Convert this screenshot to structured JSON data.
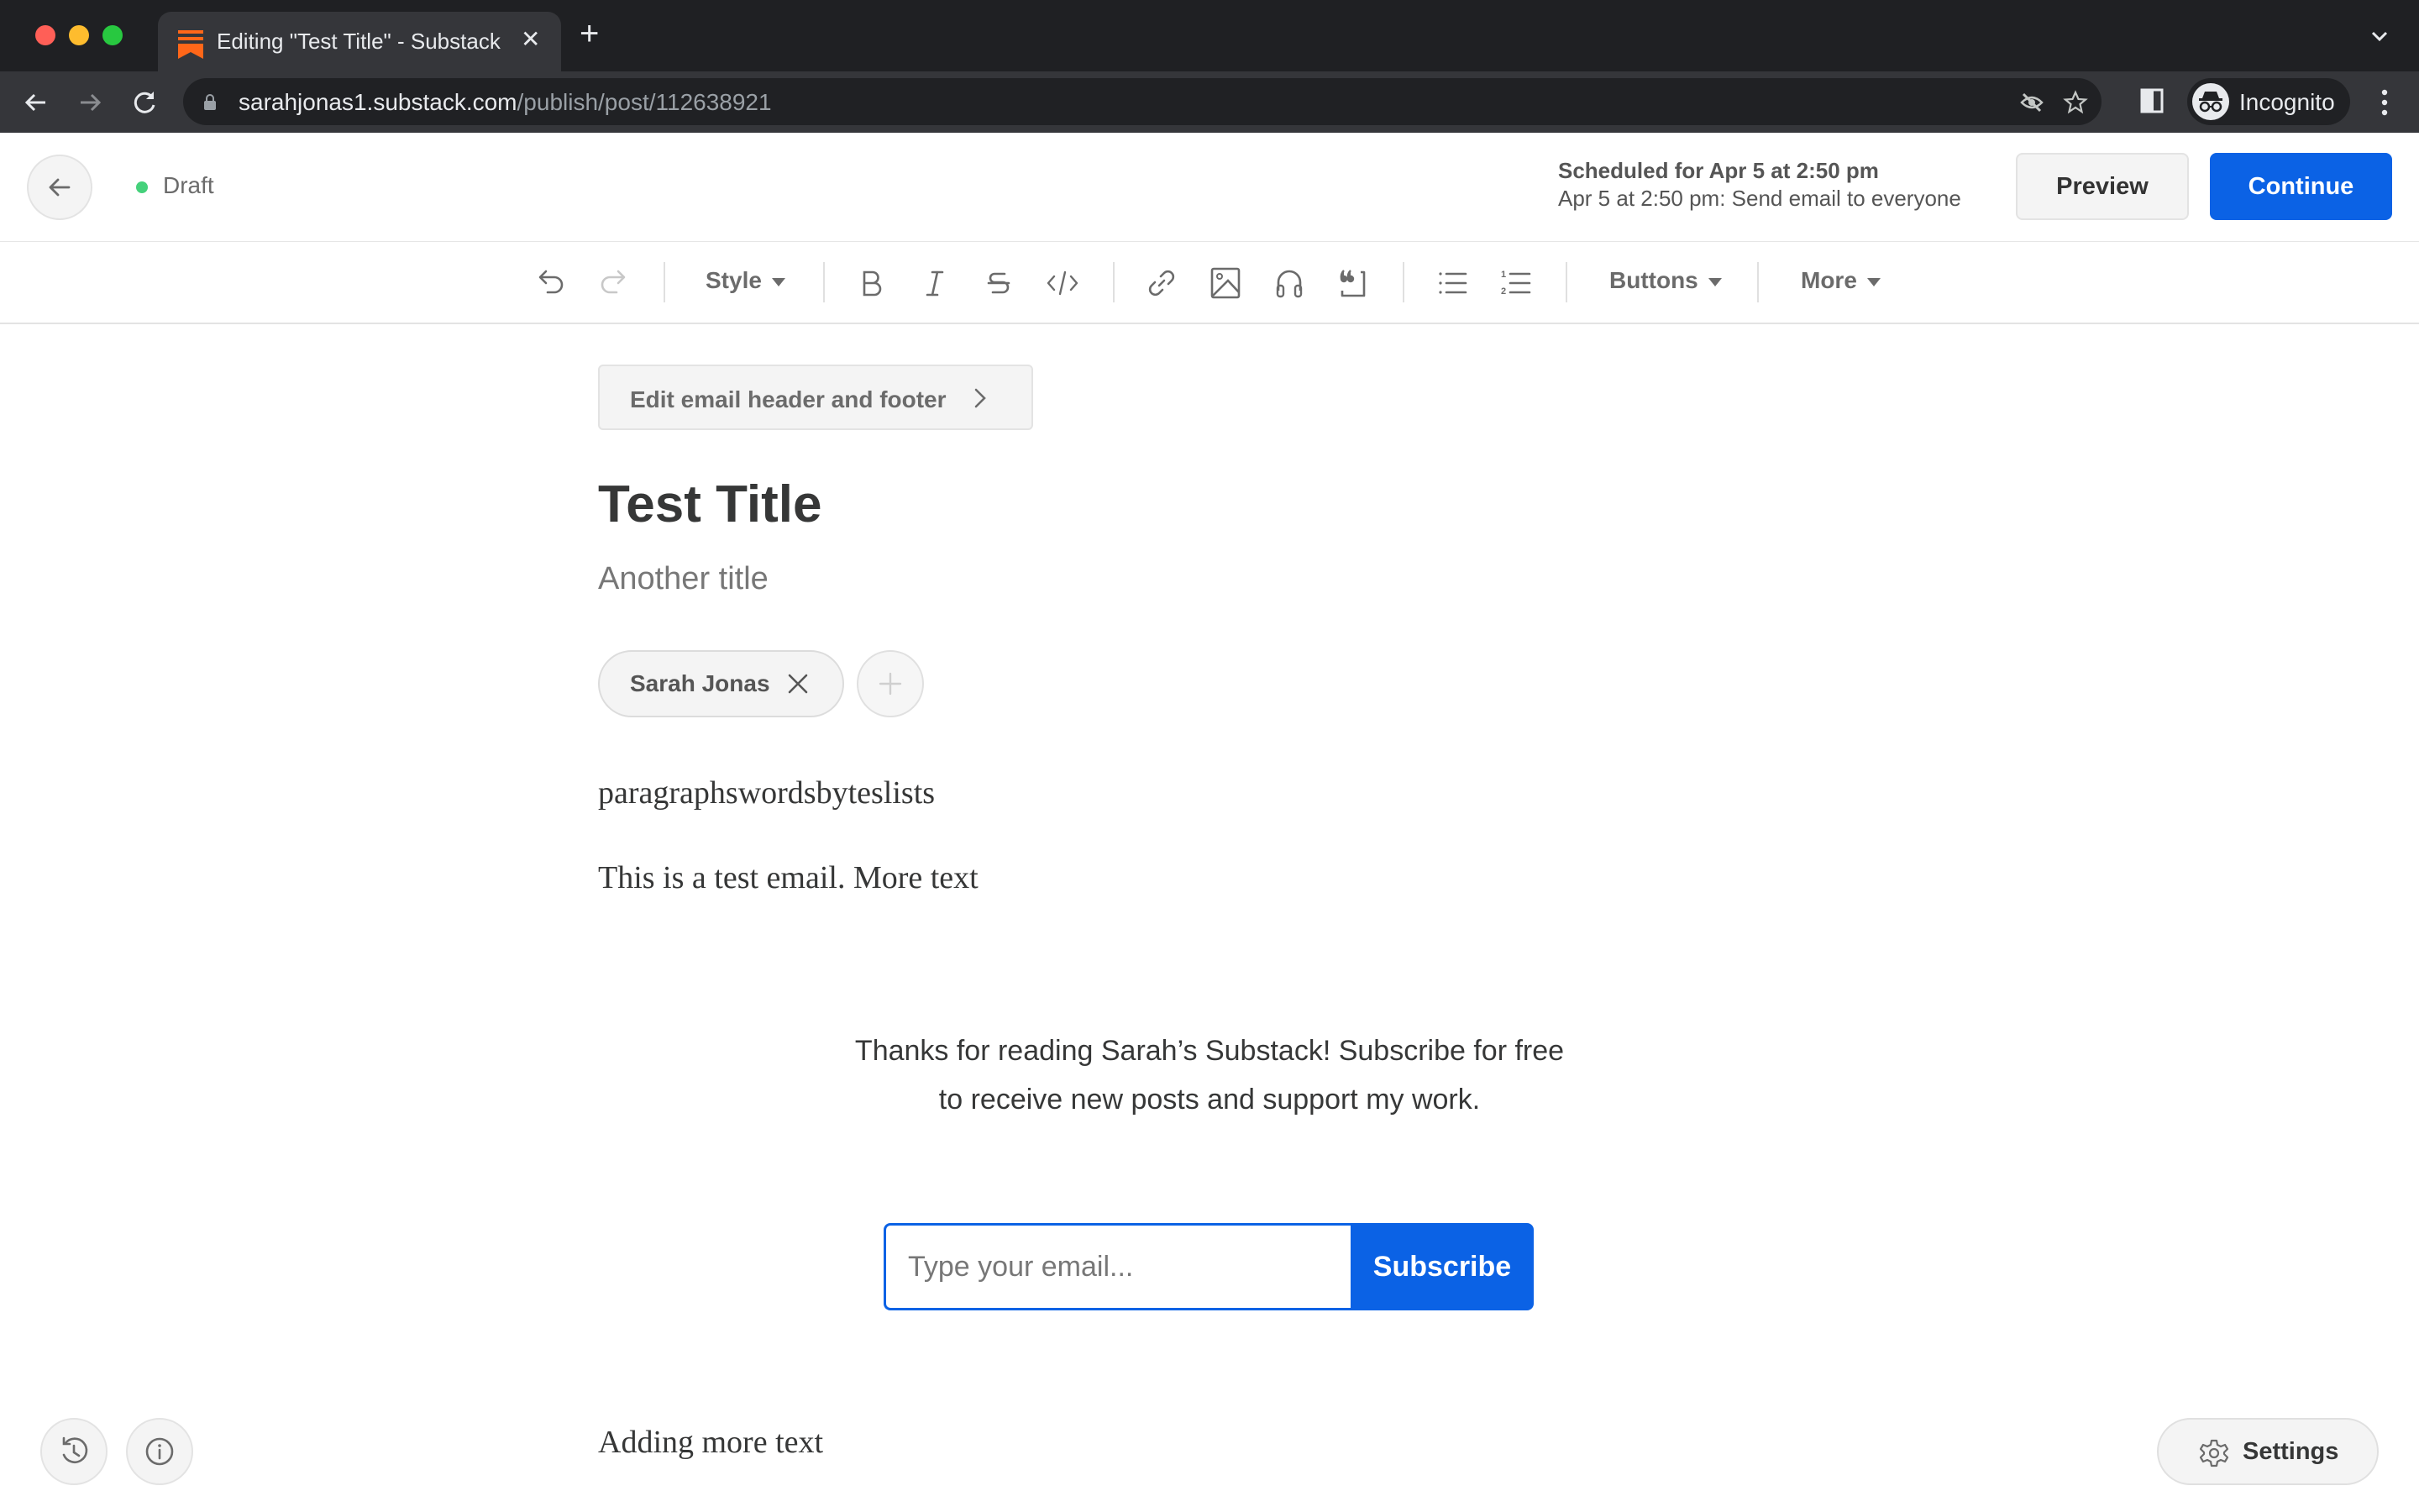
{
  "browser": {
    "tab_title": "Editing \"Test Title\" - Substack",
    "url_host": "sarahjonas1.substack.com",
    "url_path": "/publish/post/112638921",
    "profile_label": "Incognito",
    "favicon_color": "#ff6719"
  },
  "header": {
    "status_label": "Draft",
    "status_color": "#45d17b",
    "schedule_title": "Scheduled for Apr 5 at 2:50 pm",
    "schedule_detail": "Apr 5 at 2:50 pm: Send email to everyone",
    "preview_label": "Preview",
    "continue_label": "Continue",
    "accent_color": "#0b62e5"
  },
  "toolbar": {
    "style_label": "Style",
    "buttons_label": "Buttons",
    "more_label": "More",
    "icons": [
      "undo-icon",
      "redo-icon",
      "bold-icon",
      "italic-icon",
      "strikethrough-icon",
      "code-icon",
      "link-icon",
      "image-icon",
      "audio-icon",
      "quote-icon",
      "bullet-list-icon",
      "numbered-list-icon"
    ]
  },
  "editor": {
    "email_header_footer_label": "Edit email header and footer",
    "title": "Test Title",
    "subtitle": "Another title",
    "authors": [
      {
        "name": "Sarah Jonas"
      }
    ],
    "paragraphs": [
      "paragraphswordsbyteslists",
      "This is a test email. More text"
    ],
    "subscribe_widget": {
      "text": "Thanks for reading Sarah’s Substack! Subscribe for free to receive new posts and support my work.",
      "email_placeholder": "Type your email...",
      "button_label": "Subscribe"
    },
    "trailing_paragraph": "Adding more text"
  },
  "footer": {
    "settings_label": "Settings"
  }
}
